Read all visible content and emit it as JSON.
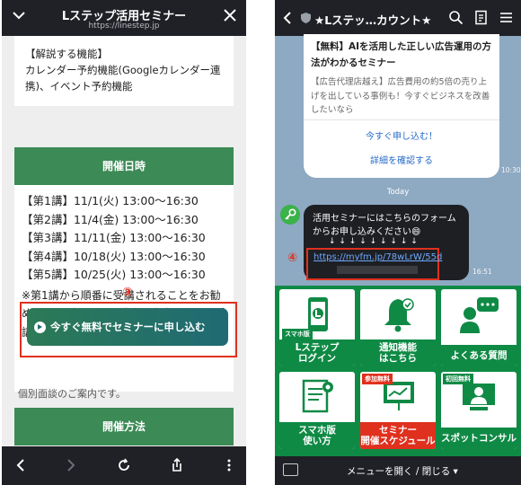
{
  "left": {
    "header": {
      "title": "Lステップ活用セミナー",
      "url": "https://linestep.jp"
    },
    "features": {
      "heading": "【解説する機能】",
      "text": "カレンダー予約機能(Googleカレンダー連携)、イベント予約機能"
    },
    "schedule_heading": "開催日時",
    "schedule": [
      "【第1講】11/1(火) 13:00〜16:30",
      "【第2講】11/4(金) 13:00〜16:30",
      "【第3講】11/11(金) 13:00〜16:30",
      "【第4講】10/18(火) 13:00〜16:30",
      "【第5講】10/25(火) 13:00〜16:30"
    ],
    "note": "※第1講から順番に受講されることをお勧めしますが、必要な講座を自由に選んで受講いただけます。",
    "cta_label": "今すぐ無料でセミナーに申し込む",
    "partial_text": "個別面談のご案内です。",
    "annotation_num": "③",
    "method_heading": "開催方法"
  },
  "right": {
    "header": {
      "title": "★Lステッ…カウント★"
    },
    "card": {
      "title": "【無料】AIを活用した正しい広告運用の方法がわかるセミナー",
      "desc": "【広告代理店越え】広告費用の約5倍の売り上げを出している事例も！今すぐビジネスを改善したいなら",
      "link1": "今すぐ申し込む！",
      "link2": "詳細を確認する",
      "time": "10:30"
    },
    "date_divider": "Today",
    "message": {
      "text": "活用セミナーにはこちらのフォームからお申し込みください😄",
      "arrows": "↓ ↓ ↓ ↓ ↓ ↓ ↓ ↓ ↓",
      "link": "https://myfm.jp/78wLrW/55d",
      "time": "16:51"
    },
    "annotation_num": "④",
    "menu": [
      {
        "label": "Lステップ\nログイン",
        "tag": "スマホ版"
      },
      {
        "label": "通知機能\nはこちら"
      },
      {
        "label": "よくある質問"
      },
      {
        "label": "スマホ版\n使い方"
      },
      {
        "label": "セミナー\n開催スケジュール",
        "tag": "参加無料"
      },
      {
        "label": "スポットコンサル",
        "tag": "初回無料"
      }
    ],
    "bottom_bar": "メニューを開く / 閉じる ▾"
  }
}
